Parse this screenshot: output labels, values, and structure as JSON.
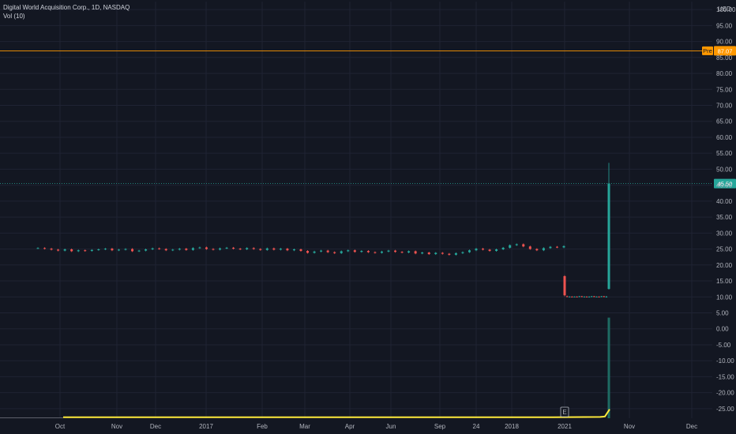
{
  "legend": {
    "title": "Digital World Acquisition Corp., 1D, NASDAQ",
    "volume": "Vol (10)"
  },
  "chart_data": {
    "type": "candlestick",
    "title": "Digital World Acquisition Corp., 1D, NASDAQ",
    "currency": "USD",
    "y_ticks": [
      100,
      95,
      90,
      85,
      80,
      75,
      70,
      65,
      60,
      55,
      50,
      45,
      40,
      35,
      30,
      25,
      20,
      15,
      10,
      5,
      0,
      -5,
      -10,
      -15,
      -20,
      -25
    ],
    "y_tick_labels": [
      "100.00",
      "95.00",
      "90.00",
      "85.00",
      "80.00",
      "75.00",
      "70.00",
      "65.00",
      "60.00",
      "55.00",
      "50.00",
      "45.00",
      "40.00",
      "35.00",
      "30.00",
      "25.00",
      "20.00",
      "15.00",
      "10.00",
      "5.00",
      "0.00",
      "-5.00",
      "-10.00",
      "-15.00",
      "-20.00",
      "-25.00"
    ],
    "ylim": [
      -28,
      102.5
    ],
    "x_tick_labels": [
      "Oct",
      "Nov",
      "Dec",
      "2017",
      "Feb",
      "Mar",
      "Apr",
      "Jun",
      "Sep",
      "24",
      "2018",
      "2021",
      "Nov",
      "Dec"
    ],
    "price_lines": [
      {
        "label": "Pre",
        "value": 87.07,
        "value_label": "87.07",
        "color": "#ff9800"
      },
      {
        "label": "",
        "value": 45.5,
        "value_label": "45.50",
        "color": "#26a69a"
      }
    ],
    "earnings_marker": "E",
    "history_segment": {
      "description_values": "daily closes around 24-26",
      "closes": [
        25.3,
        25.1,
        24.8,
        24.5,
        24.9,
        24.3,
        24.6,
        24.4,
        24.7,
        24.9,
        25.1,
        24.6,
        24.8,
        25.0,
        24.3,
        24.5,
        24.9,
        25.2,
        25.0,
        24.6,
        24.8,
        25.1,
        24.7,
        25.3,
        25.5,
        25.0,
        24.8,
        25.2,
        25.4,
        25.1,
        24.9,
        25.3,
        25.0,
        24.7,
        25.2,
        24.8,
        25.1,
        24.6,
        24.9,
        24.4,
        23.8,
        24.2,
        24.5,
        24.0,
        23.7,
        24.3,
        24.6,
        24.1,
        24.4,
        24.0,
        23.8,
        24.2,
        24.5,
        24.1,
        23.9,
        24.3,
        23.6,
        23.9,
        23.4,
        23.8,
        23.5,
        23.2,
        23.7,
        24.0,
        24.6,
        25.1,
        24.8,
        24.4,
        24.9,
        25.4,
        26.2,
        26.5,
        25.8,
        25.0,
        24.6,
        25.3,
        25.7,
        25.5,
        25.9
      ]
    },
    "spike_segment": {
      "candles": [
        {
          "o": 16.5,
          "h": 16.8,
          "l": 10.2,
          "c": 10.5
        },
        {
          "o": 10.2,
          "h": 10.4,
          "l": 9.9,
          "c": 10.0
        },
        {
          "o": 10.0,
          "h": 10.2,
          "l": 9.9,
          "c": 10.1
        },
        {
          "o": 10.1,
          "h": 10.2,
          "l": 9.9,
          "c": 10.0
        },
        {
          "o": 10.0,
          "h": 10.2,
          "l": 9.9,
          "c": 10.1
        },
        {
          "o": 10.1,
          "h": 10.2,
          "l": 9.9,
          "c": 10.0
        },
        {
          "o": 10.0,
          "h": 10.3,
          "l": 9.9,
          "c": 10.2
        },
        {
          "o": 10.2,
          "h": 10.3,
          "l": 9.9,
          "c": 10.0
        },
        {
          "o": 10.0,
          "h": 10.2,
          "l": 9.9,
          "c": 10.1
        },
        {
          "o": 10.1,
          "h": 10.2,
          "l": 9.9,
          "c": 10.0
        },
        {
          "o": 10.0,
          "h": 10.2,
          "l": 9.8,
          "c": 10.1
        },
        {
          "o": 10.1,
          "h": 10.3,
          "l": 9.9,
          "c": 10.2
        },
        {
          "o": 10.2,
          "h": 10.3,
          "l": 9.9,
          "c": 10.0
        },
        {
          "o": 10.0,
          "h": 10.2,
          "l": 9.9,
          "c": 10.1
        },
        {
          "o": 10.1,
          "h": 10.2,
          "l": 9.9,
          "c": 10.0
        },
        {
          "o": 10.0,
          "h": 10.3,
          "l": 9.9,
          "c": 10.2
        },
        {
          "o": 10.2,
          "h": 10.3,
          "l": 9.9,
          "c": 10.0
        },
        {
          "o": 10.0,
          "h": 10.3,
          "l": 9.8,
          "c": 10.1
        },
        {
          "o": 12.5,
          "h": 52.0,
          "l": 12.3,
          "c": 45.5
        }
      ]
    },
    "volume_spike": {
      "base": -28,
      "top": 3.5
    },
    "volume_ma_line": [
      [
        -28,
        -28
      ],
      [
        -26.5,
        -26.5
      ],
      [
        -26.4,
        -26.4
      ],
      [
        -26.3,
        -26.3
      ],
      [
        -26.0,
        -25.2
      ]
    ],
    "colors": {
      "up": "#26a69a",
      "down": "#ef5350",
      "volume_up": "#1e6b63",
      "volume_ma": "#ffeb3b",
      "grid": "#1f2333",
      "background": "#131722"
    }
  }
}
